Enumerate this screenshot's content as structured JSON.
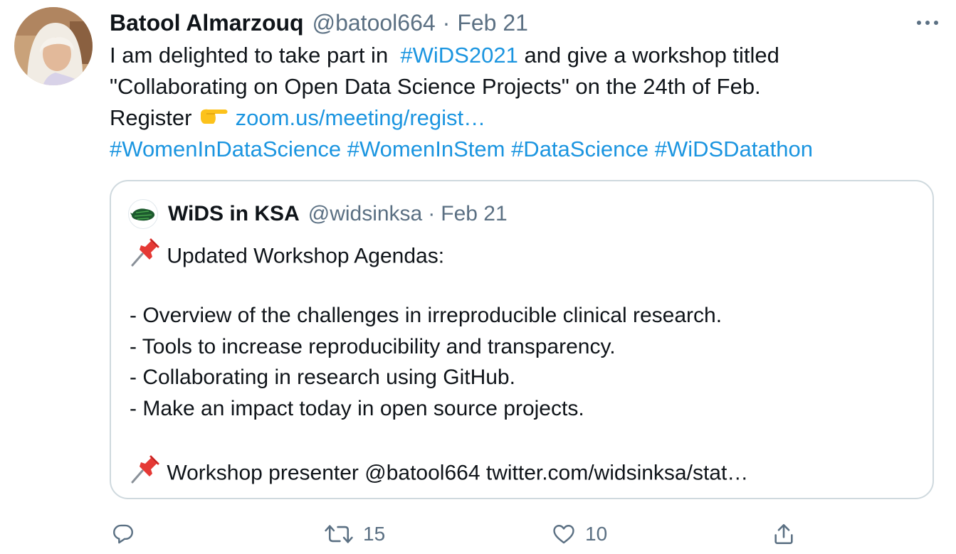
{
  "tweet": {
    "display_name": "Batool Almarzouq",
    "handle": "@batool664",
    "separator": "·",
    "date": "Feb 21",
    "text": {
      "line1_before": "I am delighted to take part in  ",
      "line1_hashtag": "#WiDS2021",
      "line1_after": " and give a workshop titled",
      "line2": "\"Collaborating on Open Data Science Projects\" on the 24th of Feb.",
      "line3_before": "Register ",
      "line3_emoji": "backhand-index-pointing-right",
      "line3_link": "zoom.us/meeting/regist…",
      "hashtags": [
        "#WomenInDataScience",
        "#WomenInStem",
        "#DataScience",
        "#WiDSDatathon"
      ]
    }
  },
  "quote": {
    "display_name": "WiDS in KSA",
    "handle": "@widsinksa",
    "separator": "·",
    "date": "Feb 21",
    "line1_emoji": "pushpin",
    "line1": "Updated Workshop Agendas:",
    "bullets": [
      "- Overview of the challenges in irreproducible clinical research.",
      "- Tools to increase reproducibility and transparency.",
      "- Collaborating in research using GitHub.",
      "- Make an impact today in open source projects."
    ],
    "last_emoji": "pushpin",
    "last_before": "Workshop presenter ",
    "last_mention": "@batool664",
    "last_link": "twitter.com/widsinksa/stat…"
  },
  "actions": {
    "reply_icon": "reply-icon",
    "retweet_icon": "retweet-icon",
    "retweet_count": "15",
    "like_icon": "heart-icon",
    "like_count": "10",
    "share_icon": "share-icon"
  },
  "colors": {
    "link": "#1b95e0",
    "muted": "#5b7083",
    "text": "#0f1419",
    "border": "#cfd9de"
  }
}
